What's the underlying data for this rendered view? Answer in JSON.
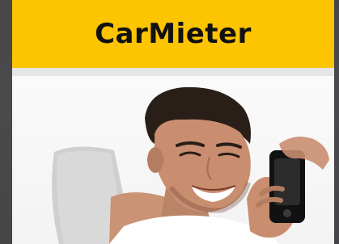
{
  "app": {
    "title": "CarMieter"
  },
  "colors": {
    "header_bg": "#fdc402",
    "frame_bg": "#4a4a4c",
    "card_bg": "#f2f2f2"
  },
  "hero_image": {
    "icon": "smiling-man-with-phone-photo"
  }
}
